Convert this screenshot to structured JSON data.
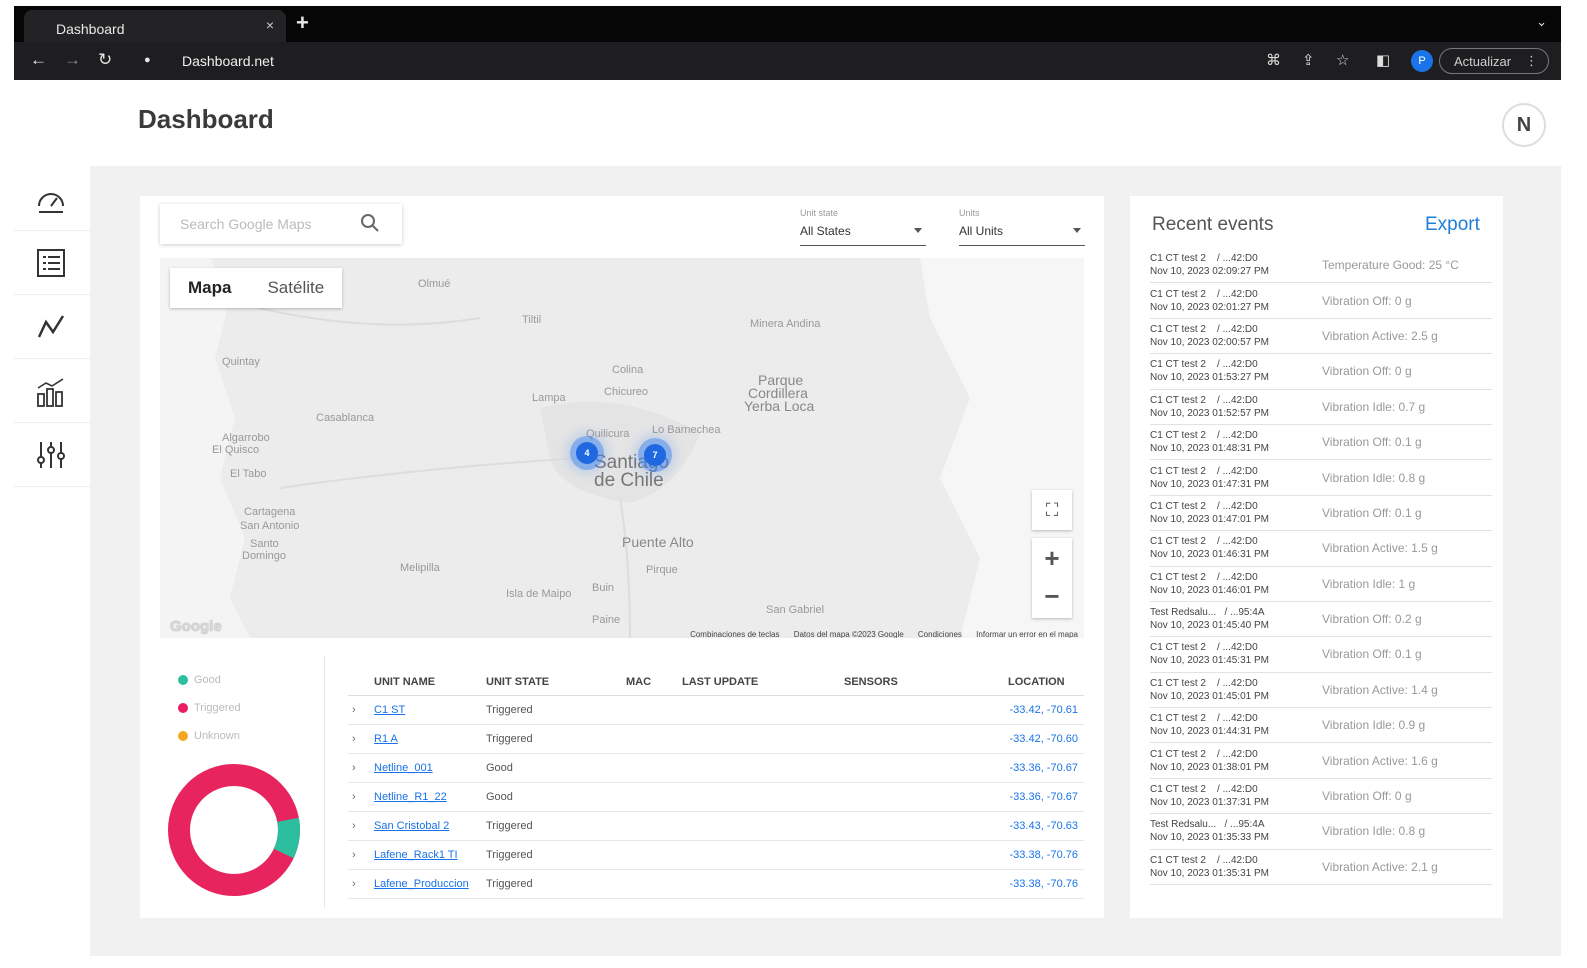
{
  "browser": {
    "tab_title": "Dashboard",
    "tab_close": "×",
    "new_tab": "+",
    "tab_menu": "⌄",
    "url": "Dashboard.net",
    "profile_initial": "P",
    "update_label": "Actualizar",
    "update_menu": "⋮"
  },
  "header": {
    "title": "Dashboard",
    "avatar_initial": "N"
  },
  "search": {
    "placeholder": "Search Google Maps"
  },
  "filters": {
    "unit_state_label": "Unit state",
    "unit_state_value": "All States",
    "units_label": "Units",
    "units_value": "All Units"
  },
  "map": {
    "type_map": "Mapa",
    "type_satellite": "Satélite",
    "places": [
      "Olmué",
      "Tiltil",
      "Minera Andina",
      "Quintay",
      "Colina",
      "Lampa",
      "Chicureo",
      "Parque",
      "Cordillera",
      "Yerba Loca",
      "Casablanca",
      "Algarrobo",
      "El Quisco",
      "El Tabo",
      "Quilicura",
      "Lo Barnechea",
      "Santiago",
      "de Chile",
      "Cartagena",
      "San Antonio",
      "Santo",
      "Domingo",
      "Puente Alto",
      "Melipilla",
      "Pirque",
      "Isla de Maipo",
      "Buin",
      "Paine",
      "San Gabriel"
    ],
    "cluster_a": "4",
    "cluster_b": "7",
    "google_logo": "Google",
    "footer_shortcuts": "Combinaciones de teclas",
    "footer_data": "Datos del mapa ©2023 Google",
    "footer_terms": "Condiciones",
    "footer_report": "Informar un error en el mapa",
    "zoom_in": "+",
    "zoom_out": "−"
  },
  "legend": [
    {
      "label": "Good",
      "color": "#2bbfa0"
    },
    {
      "label": "Triggered",
      "color": "#e91e63"
    },
    {
      "label": "Unknown",
      "color": "#f5a623"
    }
  ],
  "donut": {
    "triggered_fraction": 0.9,
    "good_fraction": 0.1,
    "triggered_color": "#e8245e",
    "good_color": "#2bbfa0"
  },
  "table": {
    "headers": {
      "unit_name": "UNIT NAME",
      "unit_state": "UNIT STATE",
      "mac": "MAC",
      "last_update": "LAST UPDATE",
      "sensors": "SENSORS",
      "location": "LOCATION"
    },
    "rows": [
      {
        "name": "C1 ST",
        "state": "Triggered",
        "location": "-33.42, -70.61"
      },
      {
        "name": "R1 A",
        "state": "Triggered",
        "location": "-33.42, -70.60"
      },
      {
        "name": "Netline_001",
        "state": "Good",
        "location": "-33.36, -70.67"
      },
      {
        "name": "Netline_R1_22",
        "state": "Good",
        "location": "-33.36, -70.67"
      },
      {
        "name": "San Cristobal 2",
        "state": "Triggered",
        "location": "-33.43, -70.63"
      },
      {
        "name": "Lafene_Rack1 TI",
        "state": "Triggered",
        "location": "-33.38, -70.76"
      },
      {
        "name": "Lafene_Produccion",
        "state": "Triggered",
        "location": "-33.38, -70.76"
      }
    ]
  },
  "events": {
    "title": "Recent events",
    "export_label": "Export",
    "items": [
      {
        "device": "C1 CT test 2    / ...42:D0",
        "time": "Nov 10, 2023 02:09:27 PM",
        "desc": "Temperature Good: 25 °C"
      },
      {
        "device": "C1 CT test 2    / ...42:D0",
        "time": "Nov 10, 2023 02:01:27 PM",
        "desc": "Vibration Off: 0 g"
      },
      {
        "device": "C1 CT test 2    / ...42:D0",
        "time": "Nov 10, 2023 02:00:57 PM",
        "desc": "Vibration Active: 2.5 g"
      },
      {
        "device": "C1 CT test 2    / ...42:D0",
        "time": "Nov 10, 2023 01:53:27 PM",
        "desc": "Vibration Off: 0 g"
      },
      {
        "device": "C1 CT test 2    / ...42:D0",
        "time": "Nov 10, 2023 01:52:57 PM",
        "desc": "Vibration Idle: 0.7 g"
      },
      {
        "device": "C1 CT test 2    / ...42:D0",
        "time": "Nov 10, 2023 01:48:31 PM",
        "desc": "Vibration Off: 0.1 g"
      },
      {
        "device": "C1 CT test 2    / ...42:D0",
        "time": "Nov 10, 2023 01:47:31 PM",
        "desc": "Vibration Idle: 0.8 g"
      },
      {
        "device": "C1 CT test 2    / ...42:D0",
        "time": "Nov 10, 2023 01:47:01 PM",
        "desc": "Vibration Off: 0.1 g"
      },
      {
        "device": "C1 CT test 2    / ...42:D0",
        "time": "Nov 10, 2023 01:46:31 PM",
        "desc": "Vibration Active: 1.5 g"
      },
      {
        "device": "C1 CT test 2    / ...42:D0",
        "time": "Nov 10, 2023 01:46:01 PM",
        "desc": "Vibration Idle: 1 g"
      },
      {
        "device": "Test Redsalu...   / ...95:4A",
        "time": "Nov 10, 2023 01:45:40 PM",
        "desc": "Vibration Off: 0.2 g"
      },
      {
        "device": "C1 CT test 2    / ...42:D0",
        "time": "Nov 10, 2023 01:45:31 PM",
        "desc": "Vibration Off: 0.1 g"
      },
      {
        "device": "C1 CT test 2    / ...42:D0",
        "time": "Nov 10, 2023 01:45:01 PM",
        "desc": "Vibration Active: 1.4 g"
      },
      {
        "device": "C1 CT test 2    / ...42:D0",
        "time": "Nov 10, 2023 01:44:31 PM",
        "desc": "Vibration Idle: 0.9 g"
      },
      {
        "device": "C1 CT test 2    / ...42:D0",
        "time": "Nov 10, 2023 01:38:01 PM",
        "desc": "Vibration Active: 1.6 g"
      },
      {
        "device": "C1 CT test 2    / ...42:D0",
        "time": "Nov 10, 2023 01:37:31 PM",
        "desc": "Vibration Off: 0 g"
      },
      {
        "device": "Test Redsalu...   / ...95:4A",
        "time": "Nov 10, 2023 01:35:33 PM",
        "desc": "Vibration Idle: 0.8 g"
      },
      {
        "device": "C1 CT test 2    / ...42:D0",
        "time": "Nov 10, 2023 01:35:31 PM",
        "desc": "Vibration Active: 2.1 g"
      }
    ]
  }
}
